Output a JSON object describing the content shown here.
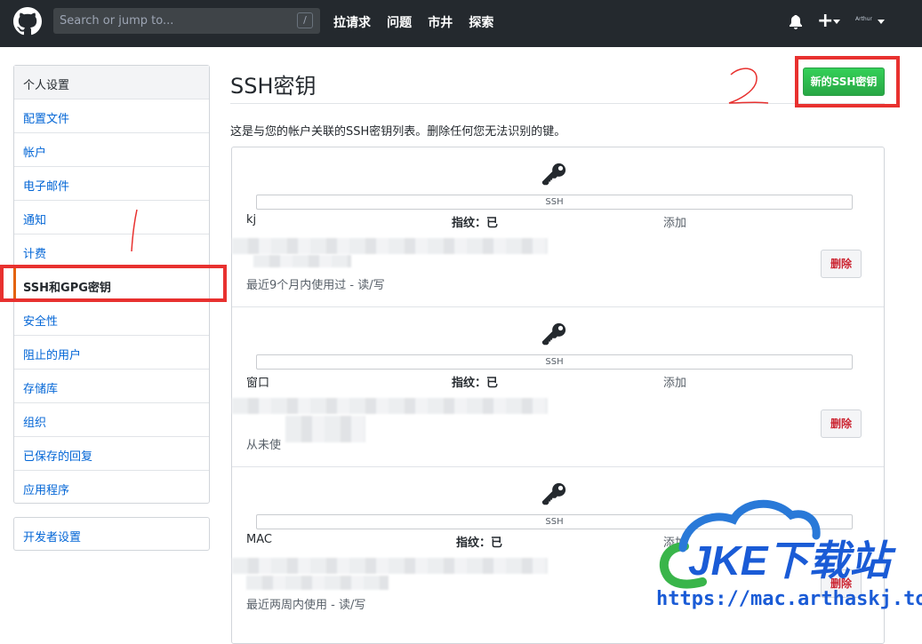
{
  "header": {
    "search_placeholder": "Search or jump to...",
    "search_hotkey": "/",
    "nav": [
      "拉请求",
      "问题",
      "市井",
      "探索"
    ],
    "plus": "+",
    "avatar_text": "Arthur"
  },
  "sidebar": {
    "heading": "个人设置",
    "items": [
      "配置文件",
      "帐户",
      "电子邮件",
      "通知",
      "计费",
      "SSH和GPG密钥",
      "安全性",
      "阻止的用户",
      "存储库",
      "组织",
      "已保存的回复",
      "应用程序"
    ],
    "selected_index": 5,
    "developer": "开发者设置"
  },
  "main": {
    "title": "SSH密钥",
    "new_button": "新的SSH密钥",
    "description": "这是与您的帐户关联的SSH密钥列表。删除任何您无法识别的键。",
    "keys": [
      {
        "badge": "SSH",
        "name": "kj",
        "fingerprint": "指纹：已",
        "added": "添加",
        "usage": "最近9个月内使用过 - 读/写",
        "delete": "删除"
      },
      {
        "badge": "SSH",
        "name": "窗口",
        "fingerprint": "指纹：已",
        "added": "添加",
        "usage": "从未使",
        "delete": "删除"
      },
      {
        "badge": "SSH",
        "name": "MAC",
        "fingerprint": "指纹：已",
        "added": "添加",
        "usage": "最近两周内使用 - 读/写",
        "delete": "删除"
      }
    ]
  },
  "annotations": {
    "sidebar_mark": "1",
    "button_mark": "2",
    "color": "#e8312f"
  },
  "watermark": {
    "brand": "JKE下载站",
    "url": "https://mac.arthaskj.top"
  }
}
